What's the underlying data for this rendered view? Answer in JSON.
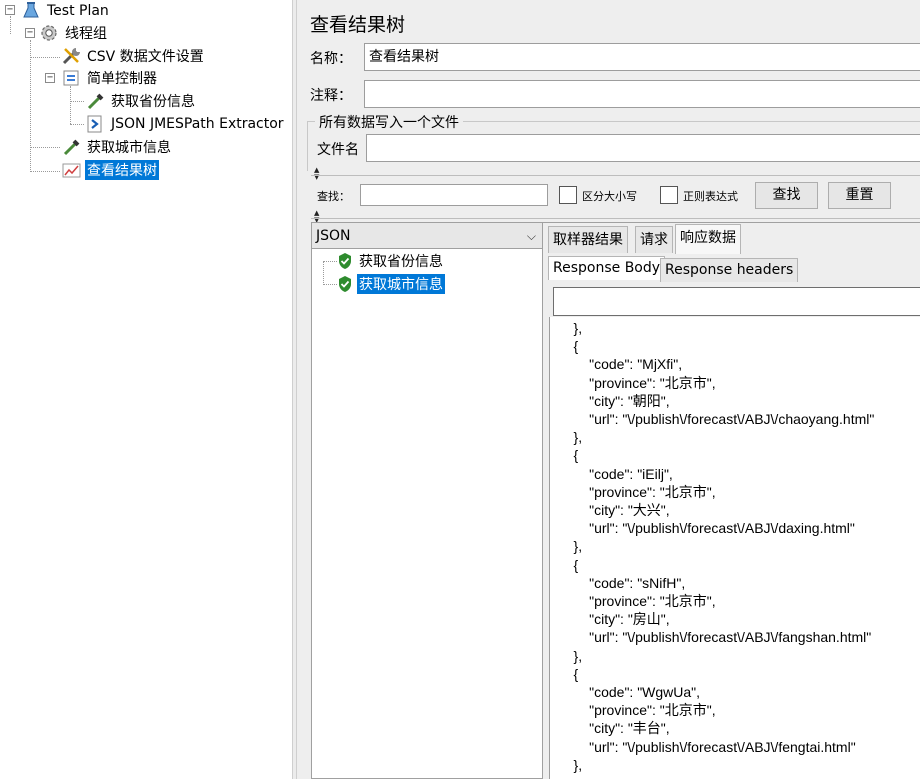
{
  "tree": {
    "test_plan": "Test Plan",
    "thread_group": "线程组",
    "csv_config": "CSV 数据文件设置",
    "simple_controller": "简单控制器",
    "get_province": "获取省份信息",
    "json_extractor": "JSON JMESPath Extractor",
    "get_city": "获取城市信息",
    "view_results_tree": "查看结果树"
  },
  "panel": {
    "title": "查看结果树",
    "name_label": "名称：",
    "name_value": "查看结果树",
    "comment_label": "注释：",
    "comment_value": "",
    "file_group_title": "所有数据写入一个文件",
    "filename_label": "文件名",
    "filename_value": ""
  },
  "search": {
    "label": "查找：",
    "value": "",
    "case_sensitive_label": "区分大小写",
    "regex_label": "正则表达式",
    "find_button": "查找",
    "reset_button": "重置"
  },
  "results": {
    "renderer": "JSON",
    "items": [
      {
        "label": "获取省份信息",
        "status": "success"
      },
      {
        "label": "获取城市信息",
        "status": "success"
      }
    ],
    "selected_index": 1
  },
  "tabs": {
    "sampler_result": "取样器结果",
    "request": "请求",
    "response_data": "响应数据",
    "active": "响应数据"
  },
  "subtabs": {
    "response_body": "Response Body",
    "response_headers": "Response headers",
    "active": "Response Body"
  },
  "response_body_text": "    },\n    {\n        \"code\": \"MjXfi\",\n        \"province\": \"北京市\",\n        \"city\": \"朝阳\",\n        \"url\": \"\\/publish\\/forecast\\/ABJ\\/chaoyang.html\"\n    },\n    {\n        \"code\": \"iEilj\",\n        \"province\": \"北京市\",\n        \"city\": \"大兴\",\n        \"url\": \"\\/publish\\/forecast\\/ABJ\\/daxing.html\"\n    },\n    {\n        \"code\": \"sNifH\",\n        \"province\": \"北京市\",\n        \"city\": \"房山\",\n        \"url\": \"\\/publish\\/forecast\\/ABJ\\/fangshan.html\"\n    },\n    {\n        \"code\": \"WgwUa\",\n        \"province\": \"北京市\",\n        \"city\": \"丰台\",\n        \"url\": \"\\/publish\\/forecast\\/ABJ\\/fengtai.html\"\n    },",
  "colors": {
    "selection": "#0078d7",
    "success_shield": "#2e8b2e",
    "panel_bg": "#eeeeee"
  }
}
